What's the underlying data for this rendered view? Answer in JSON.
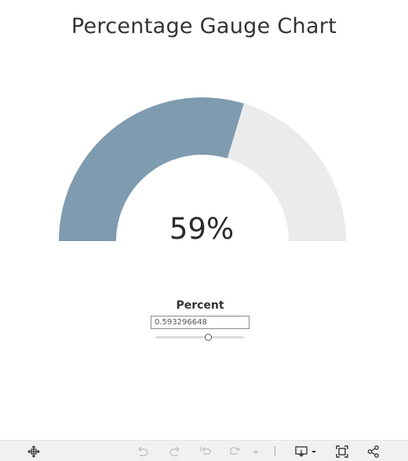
{
  "title": "Percentage Gauge Chart",
  "gauge": {
    "value": 0.593296648,
    "display_text": "59%",
    "fill_color": "#7f9bb0",
    "track_color": "#ebebeb"
  },
  "parameter": {
    "label": "Percent",
    "input_value": "0.593296648",
    "slider_min": 0,
    "slider_max": 1,
    "slider_value": 0.593296648
  },
  "toolbar": {
    "icons": [
      "move-icon",
      "undo-icon",
      "redo-icon",
      "revert-icon",
      "refresh-icon",
      "pause-dropdown-icon",
      "download-icon",
      "fullscreen-icon",
      "share-icon"
    ]
  }
}
